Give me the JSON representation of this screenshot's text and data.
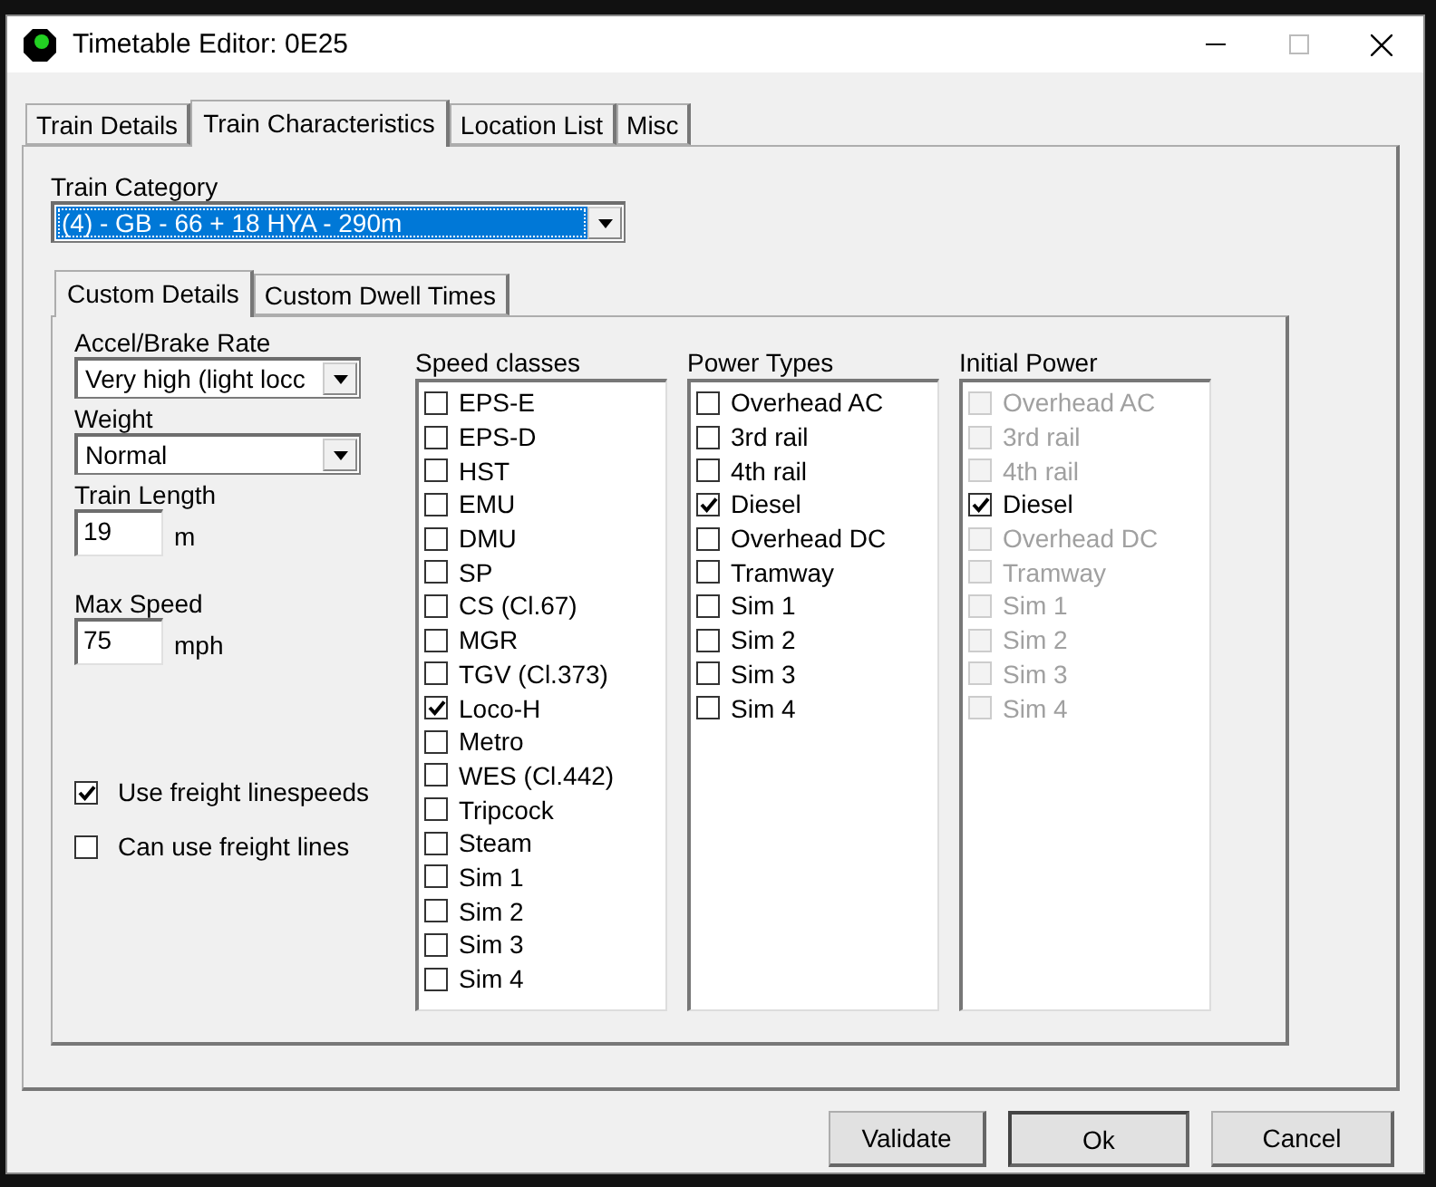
{
  "window": {
    "title": "Timetable Editor: 0E25"
  },
  "tabs": [
    {
      "label": "Train Details",
      "selected": false
    },
    {
      "label": "Train Characteristics",
      "selected": true
    },
    {
      "label": "Location List",
      "selected": false
    },
    {
      "label": "Misc",
      "selected": false
    }
  ],
  "train_category": {
    "label": "Train Category",
    "value": "(4) - GB - 66 + 18 HYA - 290m"
  },
  "inner_tabs": [
    {
      "label": "Custom Details",
      "selected": true
    },
    {
      "label": "Custom Dwell Times",
      "selected": false
    }
  ],
  "accel_brake": {
    "label": "Accel/Brake Rate",
    "value": "Very high (light locc"
  },
  "weight": {
    "label": "Weight",
    "value": "Normal"
  },
  "train_length": {
    "label": "Train Length",
    "value": "19",
    "unit": "m"
  },
  "max_speed": {
    "label": "Max Speed",
    "value": "75",
    "unit": "mph"
  },
  "options": [
    {
      "label": "Use freight linespeeds",
      "checked": true
    },
    {
      "label": "Can use freight lines",
      "checked": false
    }
  ],
  "lists": [
    {
      "title": "Speed classes",
      "items": [
        {
          "label": "EPS-E",
          "checked": false,
          "disabled": false
        },
        {
          "label": "EPS-D",
          "checked": false,
          "disabled": false
        },
        {
          "label": "HST",
          "checked": false,
          "disabled": false
        },
        {
          "label": "EMU",
          "checked": false,
          "disabled": false
        },
        {
          "label": "DMU",
          "checked": false,
          "disabled": false
        },
        {
          "label": "SP",
          "checked": false,
          "disabled": false
        },
        {
          "label": "CS (Cl.67)",
          "checked": false,
          "disabled": false
        },
        {
          "label": "MGR",
          "checked": false,
          "disabled": false
        },
        {
          "label": "TGV (Cl.373)",
          "checked": false,
          "disabled": false
        },
        {
          "label": "Loco-H",
          "checked": true,
          "disabled": false
        },
        {
          "label": "Metro",
          "checked": false,
          "disabled": false
        },
        {
          "label": "WES (Cl.442)",
          "checked": false,
          "disabled": false
        },
        {
          "label": "Tripcock",
          "checked": false,
          "disabled": false
        },
        {
          "label": "Steam",
          "checked": false,
          "disabled": false
        },
        {
          "label": "Sim 1",
          "checked": false,
          "disabled": false
        },
        {
          "label": "Sim 2",
          "checked": false,
          "disabled": false
        },
        {
          "label": "Sim 3",
          "checked": false,
          "disabled": false
        },
        {
          "label": "Sim 4",
          "checked": false,
          "disabled": false
        }
      ]
    },
    {
      "title": "Power Types",
      "items": [
        {
          "label": "Overhead AC",
          "checked": false,
          "disabled": false
        },
        {
          "label": "3rd rail",
          "checked": false,
          "disabled": false
        },
        {
          "label": "4th rail",
          "checked": false,
          "disabled": false
        },
        {
          "label": "Diesel",
          "checked": true,
          "disabled": false
        },
        {
          "label": "Overhead DC",
          "checked": false,
          "disabled": false
        },
        {
          "label": "Tramway",
          "checked": false,
          "disabled": false
        },
        {
          "label": "Sim 1",
          "checked": false,
          "disabled": false
        },
        {
          "label": "Sim 2",
          "checked": false,
          "disabled": false
        },
        {
          "label": "Sim 3",
          "checked": false,
          "disabled": false
        },
        {
          "label": "Sim 4",
          "checked": false,
          "disabled": false
        }
      ]
    },
    {
      "title": "Initial Power",
      "items": [
        {
          "label": "Overhead AC",
          "checked": false,
          "disabled": true
        },
        {
          "label": "3rd rail",
          "checked": false,
          "disabled": true
        },
        {
          "label": "4th rail",
          "checked": false,
          "disabled": true
        },
        {
          "label": "Diesel",
          "checked": true,
          "disabled": false
        },
        {
          "label": "Overhead DC",
          "checked": false,
          "disabled": true
        },
        {
          "label": "Tramway",
          "checked": false,
          "disabled": true
        },
        {
          "label": "Sim 1",
          "checked": false,
          "disabled": true
        },
        {
          "label": "Sim 2",
          "checked": false,
          "disabled": true
        },
        {
          "label": "Sim 3",
          "checked": false,
          "disabled": true
        },
        {
          "label": "Sim 4",
          "checked": false,
          "disabled": true
        }
      ]
    }
  ],
  "buttons": [
    {
      "label": "Validate",
      "default": false
    },
    {
      "label": "Ok",
      "default": true
    },
    {
      "label": "Cancel",
      "default": false
    }
  ]
}
